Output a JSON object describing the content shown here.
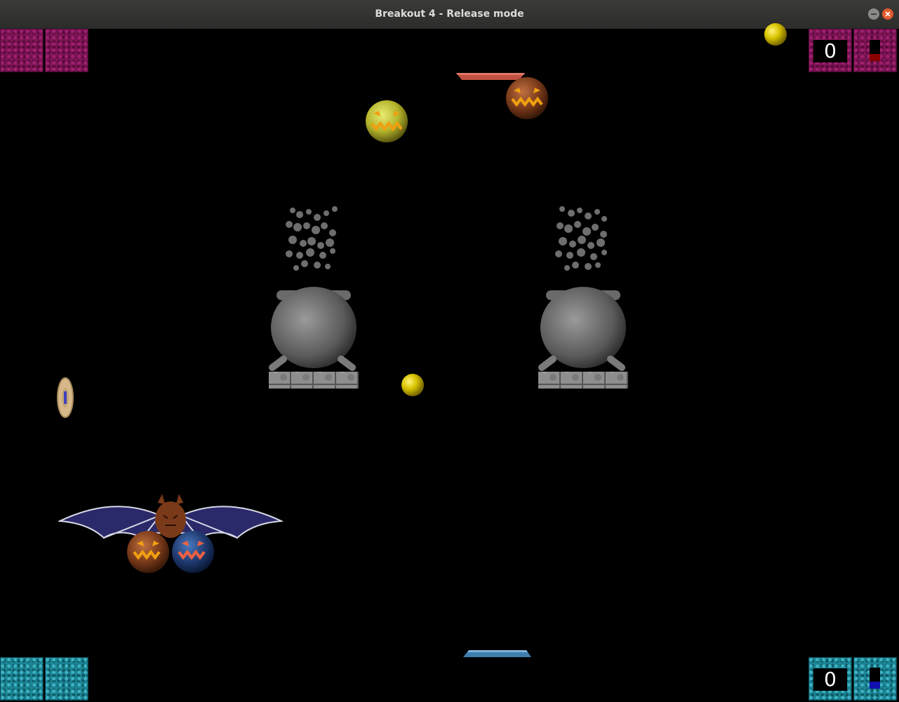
{
  "window": {
    "title": "Breakout 4 - Release mode"
  },
  "players": {
    "top": {
      "score": "0",
      "color": "#8b0000",
      "meter_level": 0.35
    },
    "bottom": {
      "score": "0",
      "color": "#1010b0",
      "meter_level": 0.35
    }
  },
  "colors": {
    "top_brick": "#7d1456",
    "bottom_brick": "#1b8595",
    "ball": "#d8c400",
    "top_paddle": "#c05040",
    "bottom_paddle": "#3f7fb0"
  },
  "icons": [
    "minimize-icon",
    "close-icon",
    "pumpkin-icon",
    "cauldron-icon",
    "bat-icon",
    "ball-icon",
    "coin-icon"
  ]
}
